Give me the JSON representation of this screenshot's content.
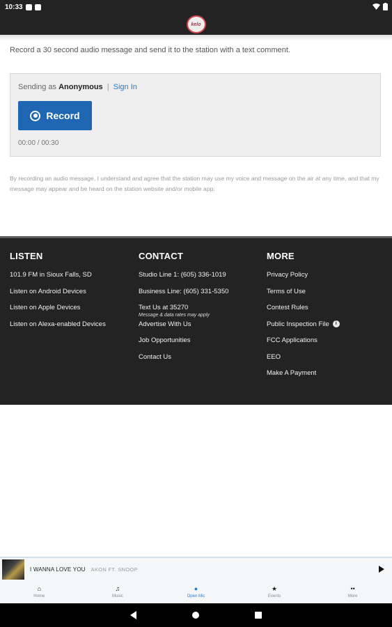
{
  "status_bar": {
    "time": "10:33",
    "icons": [
      "notification-icon",
      "sd-card-icon",
      "wifi-icon",
      "battery-icon"
    ]
  },
  "app_bar": {
    "logo_text": "kelo"
  },
  "page": {
    "intro": "Record a 30 second audio message and send it to the station with a text comment.",
    "sending_prefix": "Sending as",
    "sending_user": "Anonymous",
    "separator": "|",
    "sign_in": "Sign In",
    "record_label": "Record",
    "timer": "00:00 / 00:30",
    "disclaimer": "By recording an audio message, I understand and agree that the station may use my voice and message on the air at any time, and that my message may appear and be heard on the station website and/or mobile app."
  },
  "footer": {
    "listen": {
      "title": "LISTEN",
      "items": [
        "101.9 FM in Sioux Falls, SD",
        "Listen on Android Devices",
        "Listen on Apple Devices",
        "Listen on Alexa-enabled Devices"
      ]
    },
    "contact": {
      "title": "CONTACT",
      "items": [
        "Studio Line 1: (605) 336-1019",
        "Business Line: (605) 331-5350",
        "Text Us at 35270"
      ],
      "text_note": "Message & data rates may apply",
      "items2": [
        "Advertise With Us",
        "Job Opportunities",
        "Contact Us"
      ]
    },
    "more": {
      "title": "MORE",
      "items": [
        "Privacy Policy",
        "Terms of Use",
        "Contest Rules",
        "Public Inspection File",
        "FCC Applications",
        "EEO",
        "Make A Payment"
      ]
    }
  },
  "now_playing": {
    "title": "I WANNA LOVE YOU",
    "artist": "AKON FT. SNOOP"
  },
  "bottom_nav": {
    "tabs": [
      {
        "label": "Home",
        "icon": "home-icon"
      },
      {
        "label": "Music",
        "icon": "music-note-icon"
      },
      {
        "label": "Open Mic",
        "icon": "microphone-icon"
      },
      {
        "label": "Events",
        "icon": "star-icon"
      },
      {
        "label": "More",
        "icon": "more-icon"
      }
    ],
    "active_index": 2,
    "accent_color": "#2a7bd1"
  }
}
